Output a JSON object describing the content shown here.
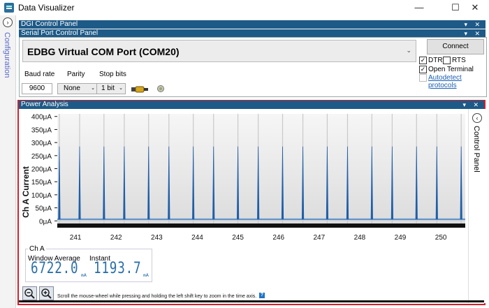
{
  "window": {
    "title": "Data Visualizer",
    "minimize": "—",
    "maximize": "☐",
    "close": "✕"
  },
  "sidebar": {
    "toggle": "›",
    "label": "Configuration"
  },
  "dgi_panel": {
    "title": "DGI Control Panel",
    "controls": "▾ ✕"
  },
  "serial_panel": {
    "title": "Serial Port Control Panel",
    "controls": "▾ ✕",
    "port": "EDBG Virtual COM Port (COM20)",
    "connect_label": "Connect",
    "baud_label": "Baud rate",
    "baud_value": "9600",
    "parity_label": "Parity",
    "parity_value": "None",
    "stop_label": "Stop bits",
    "stop_value": "1 bit",
    "dtr_label": "DTR",
    "rts_label": "RTS",
    "open_terminal_label": "Open Terminal",
    "autodetect_label": "Autodetect protocols",
    "dtr_checked": true,
    "rts_checked": false,
    "open_terminal_checked": true,
    "autodetect_checked": false
  },
  "power_panel": {
    "title": "Power Analysis",
    "controls": "▾ ✕",
    "control_panel_label": "Control Panel",
    "control_panel_toggle": "‹",
    "ch_label": "Ch A",
    "window_average_label": "Window Average",
    "instant_label": "Instant",
    "window_average_value": "6722.0",
    "instant_value": "1193.7",
    "unit": "nA",
    "hint": "Scroll the mouse-wheel while pressing and holding the left shift key to zoom in the time axis.",
    "info": "?"
  },
  "chart_data": {
    "type": "line",
    "ylabel": "Ch A Current",
    "y_ticks": [
      "0μA",
      "50μA",
      "100μA",
      "150μA",
      "200μA",
      "250μA",
      "300μA",
      "350μA",
      "400μA"
    ],
    "y_tick_values": [
      0,
      50,
      100,
      150,
      200,
      250,
      300,
      350,
      400
    ],
    "x_ticks": [
      "241",
      "242",
      "243",
      "244",
      "245",
      "246",
      "247",
      "248",
      "249",
      "250"
    ],
    "x_tick_values": [
      241,
      242,
      243,
      244,
      245,
      246,
      247,
      248,
      249,
      250
    ],
    "xlim": [
      240.55,
      250.6
    ],
    "ylim": [
      -10,
      410
    ],
    "baseline": 6,
    "spike_peak": 285,
    "spikes_x": [
      240.6,
      241.1,
      241.7,
      242.2,
      242.8,
      243.3,
      243.9,
      244.4,
      245.0,
      245.5,
      246.1,
      246.6,
      247.2,
      247.7,
      248.3,
      248.8,
      249.4,
      249.9,
      250.5
    ],
    "grid": "vertical",
    "color": "#1f5ea8"
  }
}
